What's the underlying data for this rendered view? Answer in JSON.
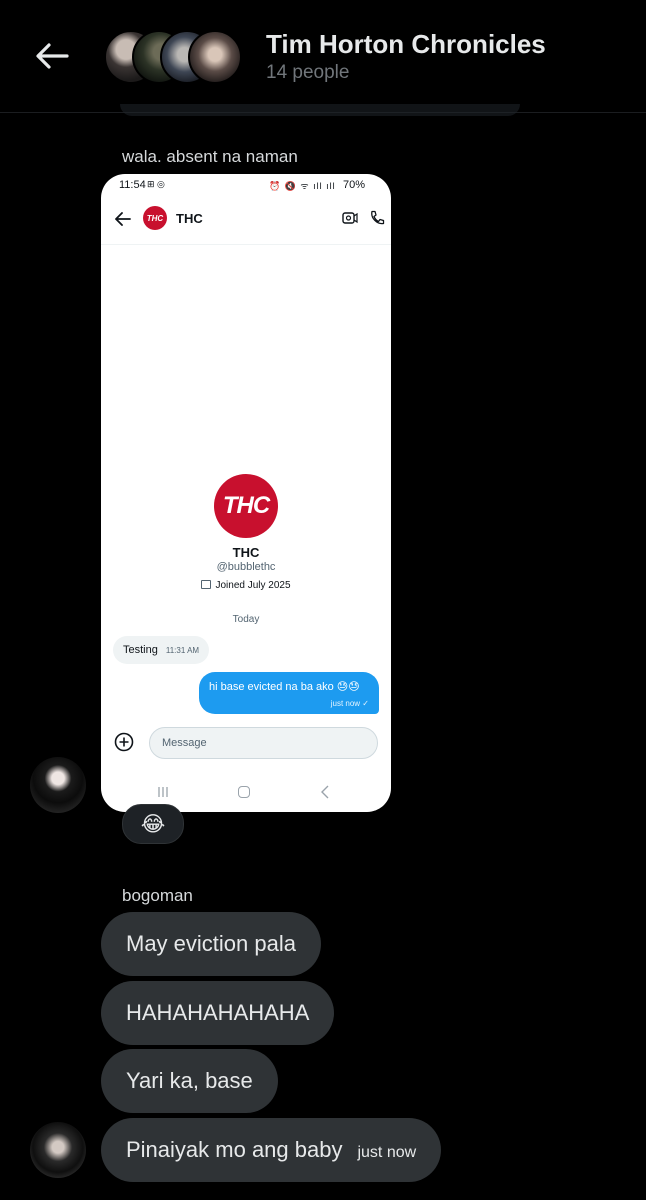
{
  "header": {
    "title": "Tim Horton Chronicles",
    "member_count": "14 people"
  },
  "messages": {
    "first_sender": "wala. absent na naman",
    "reaction_emoji": "😂",
    "second_sender": "bogoman",
    "bubbles": [
      "May eviction pala",
      "HAHAHAHAHAHA",
      "Yari ka, base",
      "Pinaiyak mo ang baby"
    ],
    "last_time": "just now"
  },
  "attachment": {
    "status_time": "11:54",
    "status_left_icons": "⊞ ◎",
    "status_right_icons": "⏰ 🔇 ᯤ ıll ıll",
    "status_battery": "70%",
    "chat_name": "THC",
    "logo_text": "THC",
    "profile_name": "THC",
    "profile_handle": "@bubblethc",
    "profile_joined": "Joined July 2025",
    "date_divider": "Today",
    "incoming_text": "Testing",
    "incoming_time": "11:31 AM",
    "outgoing_text": "hi base evicted na ba ako 😓😓",
    "outgoing_time": "just now ✓",
    "composer_placeholder": "Message"
  },
  "colors": {
    "background": "#000000",
    "bubble": "#2f3336",
    "accent_blue": "#1d9bf0",
    "brand_red": "#c8102e"
  }
}
